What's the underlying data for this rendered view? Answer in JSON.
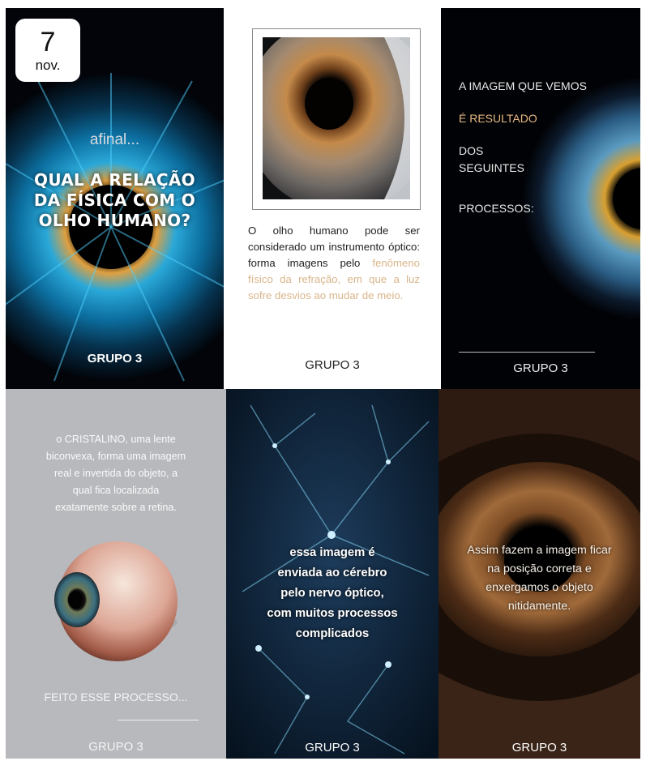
{
  "date_badge": {
    "day": "7",
    "month": "nov."
  },
  "tile1": {
    "intro": "afinal...",
    "question": [
      "QUAL A RELAÇÃO",
      "DA FÍSICA COM O",
      "OLHO HUMANO?"
    ],
    "footer": "GRUPO 3"
  },
  "tile2": {
    "body_dark": "O olho humano pode ser considerado um instrumento óptico: forma imagens pelo",
    "body_highlight": "fenômeno físico da refração, em que a luz sofre desvios ao mudar de meio.",
    "footer": "GRUPO 3"
  },
  "tile3": {
    "line1": "A IMAGEM QUE VEMOS",
    "line2": "É RESULTADO",
    "line3": "DOS",
    "line4": "SEGUINTES",
    "line5": "PROCESSOS:",
    "footer": "GRUPO 3"
  },
  "tile4": {
    "lines": [
      "o CRISTALINO, uma lente",
      "biconvexa, forma uma imagem",
      "real e invertida do objeto, a",
      "qual fica localizada",
      "exatamente sobre a retina."
    ],
    "step": "FEITO ESSE PROCESSO...",
    "footer": "GRUPO 3"
  },
  "tile5": {
    "lines": [
      "essa imagem é",
      "enviada ao cérebro",
      "pelo nervo óptico,",
      "com muitos processos",
      "complicados"
    ],
    "footer": "GRUPO 3"
  },
  "tile6": {
    "lines": [
      "Assim fazem a imagem ficar",
      "na posição correta e",
      "enxergamos o objeto",
      "nitidamente."
    ],
    "footer": "GRUPO 3"
  },
  "colors": {
    "highlight": "#d9b58a",
    "tile4_bg": "#b8b9bd",
    "dark_bg": "#020409"
  }
}
